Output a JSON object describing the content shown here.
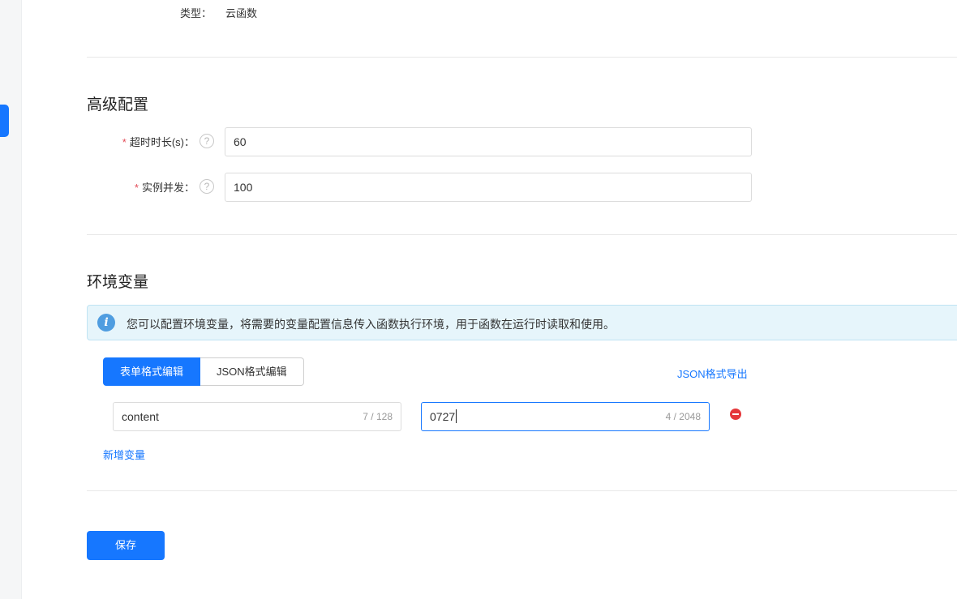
{
  "basic": {
    "type_label": "类型：",
    "type_value": "云函数"
  },
  "advanced": {
    "title": "高级配置",
    "timeout": {
      "required_mark": "*",
      "label": "超时时长(s)：",
      "value": "60"
    },
    "concurrency": {
      "required_mark": "*",
      "label": "实例并发：",
      "value": "100"
    }
  },
  "env": {
    "title": "环境变量",
    "info_text": "您可以配置环境变量，将需要的变量配置信息传入函数执行环境，用于函数在运行时读取和使用。",
    "tabs": [
      {
        "label": "表单格式编辑",
        "active": true
      },
      {
        "label": "JSON格式编辑",
        "active": false
      }
    ],
    "export_link": "JSON格式导出",
    "variables": [
      {
        "key": "content",
        "key_counter": "7 / 128",
        "value": "0727",
        "value_counter": "4 / 2048"
      }
    ],
    "add_link": "新增变量"
  },
  "footer": {
    "save_label": "保存"
  },
  "colors": {
    "primary": "#1677ff",
    "danger": "#e5373a",
    "info_bg": "#e6f5fb",
    "required": "#e34d59"
  }
}
